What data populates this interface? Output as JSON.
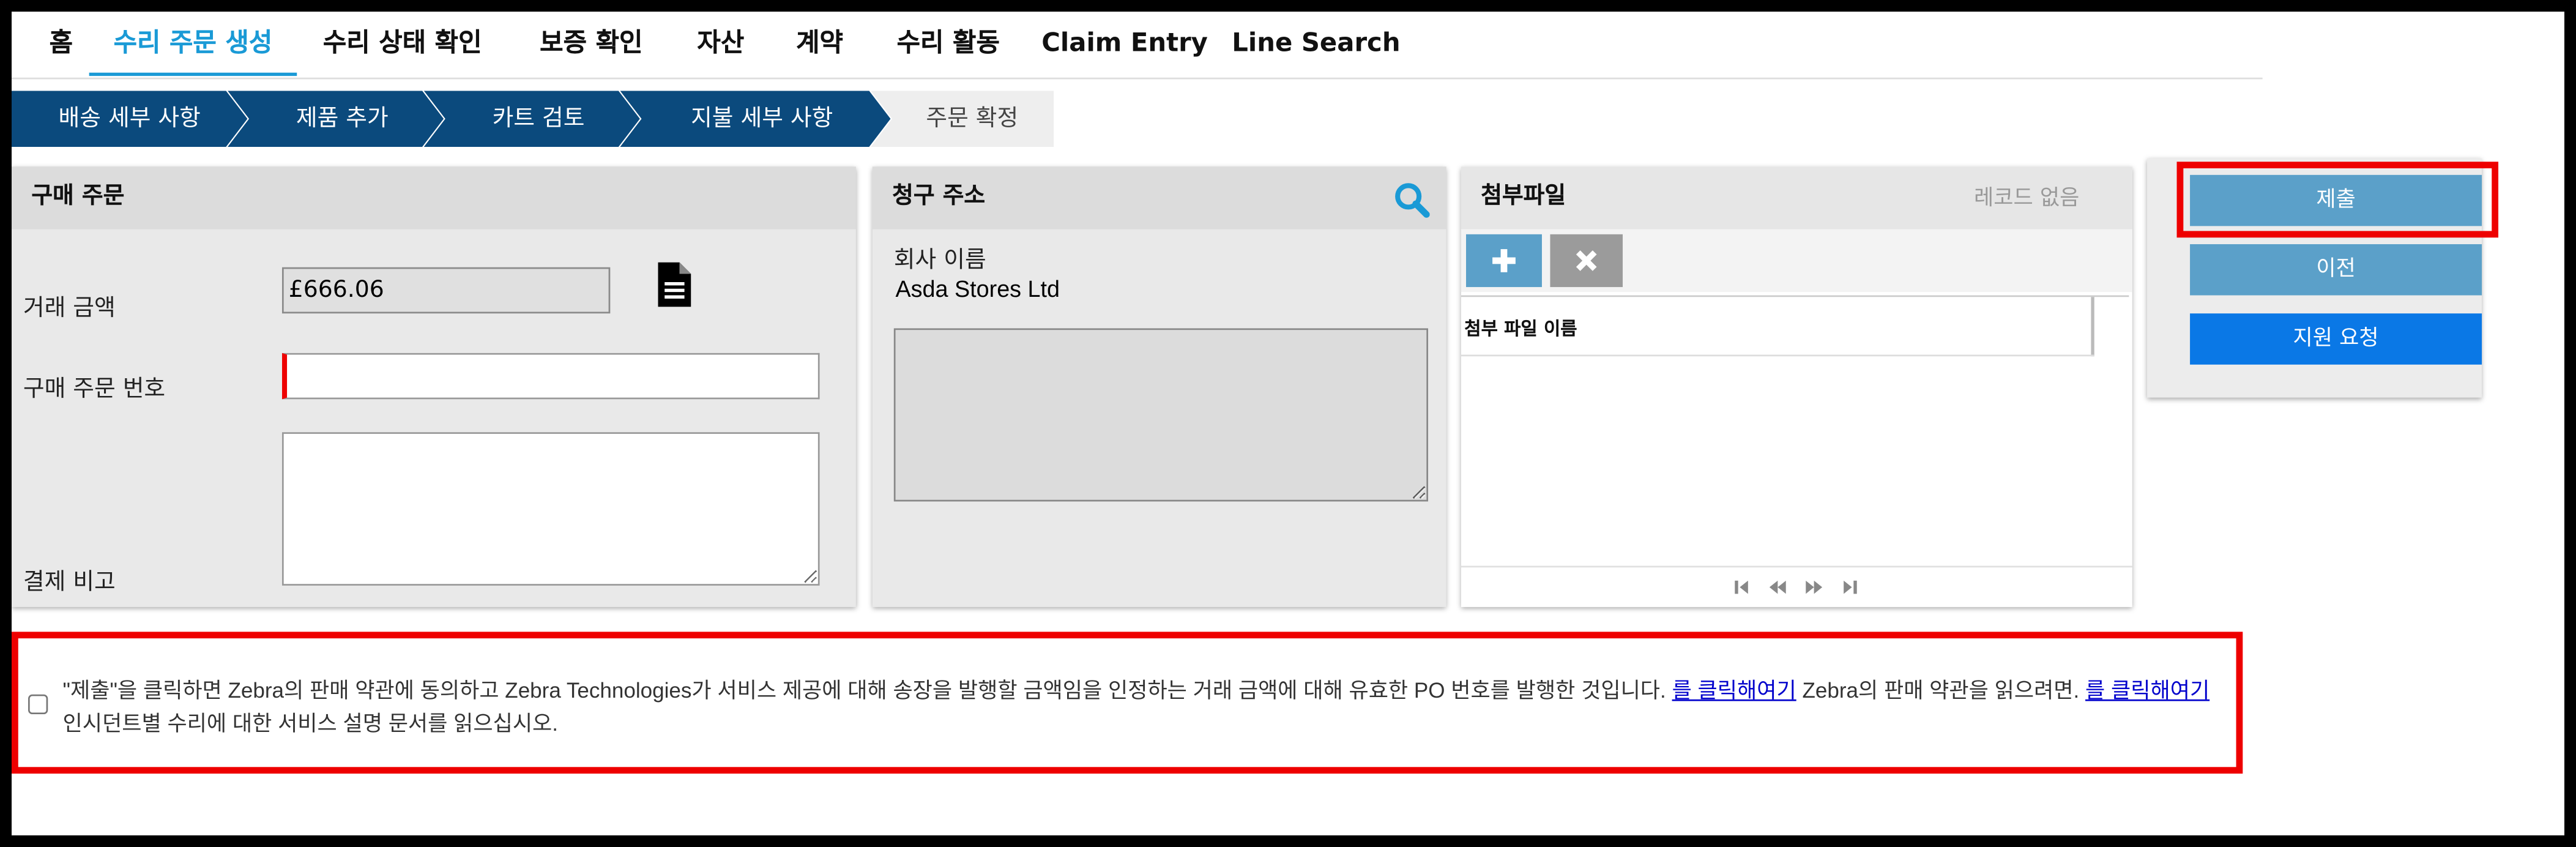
{
  "nav": {
    "tabs": [
      "홈",
      "수리 주문 생성",
      "수리 상태 확인",
      "보증 확인",
      "자산",
      "계약",
      "수리 활동",
      "Claim Entry",
      "Line Search"
    ],
    "active_tab": "수리 주문 생성"
  },
  "steps": [
    "배송 세부 사항",
    "제품 추가",
    "카트 검토",
    "지불 세부 사항",
    "주문 확정"
  ],
  "current_step": "주문 확정",
  "purchase_order": {
    "title": "구매 주문",
    "amount_label": "거래 금액",
    "amount_value": "£666.06",
    "amount_icon": "document-icon",
    "po_number_label": "구매 주문 번호",
    "po_number_value": "",
    "payment_note_label": "결제 비고",
    "payment_note_value": ""
  },
  "billing_address": {
    "title": "청구 주소",
    "search_icon": "search-icon",
    "company_label": "회사 이름",
    "company_value": "Asda Stores Ltd",
    "address_value": ""
  },
  "attachments": {
    "title": "첨부파일",
    "record_status": "레코드 없음",
    "add_icon": "plus-icon",
    "delete_icon": "x-icon",
    "column_header": "첨부 파일 이름",
    "pager_icons": [
      "first-page-icon",
      "previous-page-icon",
      "next-page-icon",
      "last-page-icon"
    ]
  },
  "actions": {
    "submit_label": "제출",
    "previous_label": "이전",
    "support_label": "지원 요청"
  },
  "terms": {
    "checked": false,
    "text1": "\"제출\"을 클릭하면 Zebra의 판매 약관에 동의하고 Zebra Technologies가 서비스 제공에 대해 송장을 발행할 금액임을 인정하는 거래 금액에 대해 유효한 PO 번호를 발행한 것입니다.",
    "link1": "를 클릭해여기",
    "text2": "Zebra의 판매 약관을 읽으려면.",
    "link2": "를 클릭해여기",
    "text3": "인시던트별 수리에 대한 서비스 설명 문서를 읽으십시오."
  },
  "colors": {
    "nav_active": "#1a9ad6",
    "step_done": "#0b4a7d",
    "step_current_bg": "#eeeeee",
    "button_blue_light": "#5ba0c9",
    "button_blue": "#0a78e6",
    "highlight_red": "#ee0000",
    "panel_bg": "#e9e9e9",
    "panel_header": "#dcdcdc"
  }
}
